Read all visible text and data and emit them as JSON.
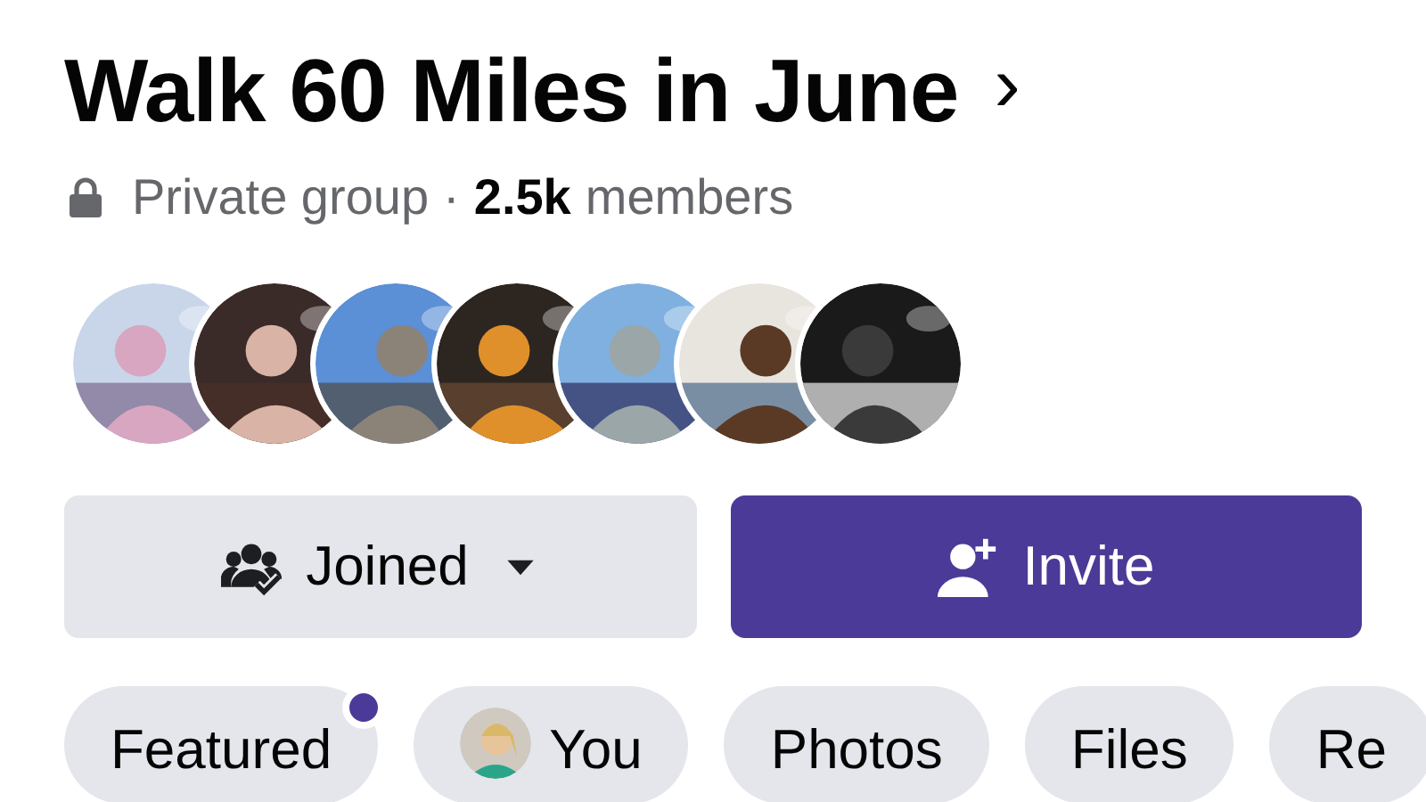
{
  "group": {
    "title": "Walk 60 Miles in June",
    "chevron": "›",
    "privacy": "Private group",
    "separator": "·",
    "member_count": "2.5k",
    "member_label": "members"
  },
  "actions": [
    {
      "kind": "joined",
      "label": "Joined"
    },
    {
      "kind": "invite",
      "label": "Invite"
    }
  ],
  "tabs": [
    {
      "label": "Featured",
      "unread": true,
      "avatar": false
    },
    {
      "label": "You",
      "unread": false,
      "avatar": true
    },
    {
      "label": "Photos",
      "unread": false,
      "avatar": false
    },
    {
      "label": "Files",
      "unread": false,
      "avatar": false
    },
    {
      "label": "Re",
      "unread": false,
      "avatar": false
    }
  ]
}
